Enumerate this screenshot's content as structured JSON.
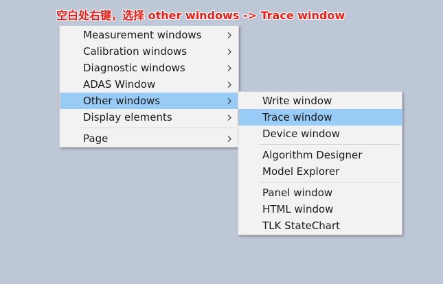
{
  "annotation": {
    "text": "空白处右键，选择 other windows -> Trace window",
    "color": "#f01a14"
  },
  "desktop": {
    "background_color": "#bdc7d6"
  },
  "main_menu": {
    "items": [
      {
        "label": "Measurement windows",
        "has_submenu": true,
        "icon": "chevron-right-icon"
      },
      {
        "label": "Calibration windows",
        "has_submenu": true,
        "icon": "chevron-right-icon"
      },
      {
        "label": "Diagnostic windows",
        "has_submenu": true,
        "icon": "chevron-right-icon"
      },
      {
        "label": "ADAS Window",
        "has_submenu": true,
        "icon": "chevron-right-icon"
      },
      {
        "label": "Other windows",
        "has_submenu": true,
        "highlighted": true,
        "icon": "chevron-right-icon"
      },
      {
        "label": "Display elements",
        "has_submenu": true,
        "icon": "chevron-right-icon"
      },
      {
        "label": "Page",
        "has_submenu": true,
        "icon": "chevron-right-icon"
      }
    ]
  },
  "sub_menu": {
    "items": [
      {
        "label": "Write window"
      },
      {
        "label": "Trace window",
        "highlighted": true
      },
      {
        "label": "Device window"
      },
      {
        "label": "Algorithm Designer"
      },
      {
        "label": "Model Explorer"
      },
      {
        "label": "Panel window"
      },
      {
        "label": "HTML window"
      },
      {
        "label": "TLK StateChart"
      }
    ]
  },
  "colors": {
    "highlight": "#99cbf7",
    "menu_background": "#f2f2f2",
    "separator": "#d4d4d4"
  }
}
